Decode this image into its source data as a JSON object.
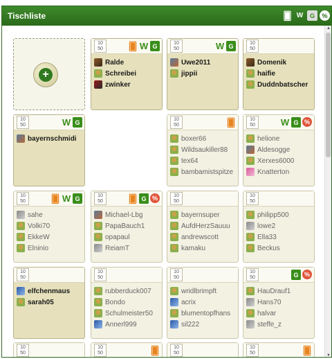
{
  "header": {
    "title": "Tischliste",
    "icons": [
      "cards-icon",
      "w-icon",
      "g-icon",
      "percent-icon"
    ],
    "w_label": "W",
    "g_label": "G",
    "pct_label": "%"
  },
  "tables": [
    {
      "type": "join",
      "min": "10",
      "max": "50"
    },
    {
      "min": "10",
      "max": "50",
      "filled": true,
      "badges": [
        "cards",
        "w",
        "g"
      ],
      "players": [
        {
          "name": "Ralde",
          "avatar": "photo1"
        },
        {
          "name": "Schreibei",
          "avatar": "green"
        },
        {
          "name": "zwinker",
          "avatar": "red"
        }
      ]
    },
    {
      "min": "10",
      "max": "50",
      "filled": true,
      "badges": [
        "w",
        "g"
      ],
      "players": [
        {
          "name": "Uwe2011",
          "avatar": "photo2"
        },
        {
          "name": "jippii",
          "avatar": "green"
        }
      ]
    },
    {
      "min": "10",
      "max": "50",
      "filled": true,
      "badges": [],
      "players": [
        {
          "name": "Domenik",
          "avatar": "photo1"
        },
        {
          "name": "haifie",
          "avatar": "green"
        },
        {
          "name": "Duddnbatscher",
          "avatar": "green"
        }
      ]
    },
    {
      "min": "10",
      "max": "50",
      "filled": true,
      "badges": [
        "w",
        "g"
      ],
      "players": [
        {
          "name": "bayernschmidi",
          "avatar": "photo2"
        }
      ]
    },
    {
      "type": "none"
    },
    {
      "min": "10",
      "max": "50",
      "filled": false,
      "badges": [
        "cards"
      ],
      "players": [
        {
          "name": "boxer66",
          "avatar": "green"
        },
        {
          "name": "Wildsaukiller88",
          "avatar": "green"
        },
        {
          "name": "tex64",
          "avatar": "green"
        },
        {
          "name": "bambamistspitze",
          "avatar": "green"
        }
      ]
    },
    {
      "min": "10",
      "max": "50",
      "filled": false,
      "badges": [
        "w",
        "g",
        "pct"
      ],
      "players": [
        {
          "name": "helione",
          "avatar": "green"
        },
        {
          "name": "Aldesogge",
          "avatar": "photo2"
        },
        {
          "name": "Xerxes6000",
          "avatar": "green"
        },
        {
          "name": "Knatterton",
          "avatar": "pink"
        }
      ]
    },
    {
      "min": "10",
      "max": "50",
      "filled": false,
      "badges": [
        "cards",
        "w",
        "g"
      ],
      "players": [
        {
          "name": "sahe",
          "avatar": "grey"
        },
        {
          "name": "Volki70",
          "avatar": "green"
        },
        {
          "name": "EkkeW",
          "avatar": "green"
        },
        {
          "name": "Elninio",
          "avatar": "green"
        }
      ]
    },
    {
      "min": "10",
      "max": "50",
      "filled": false,
      "badges": [
        "cards",
        "g",
        "pct"
      ],
      "players": [
        {
          "name": "Michael-Lbg",
          "avatar": "photo2"
        },
        {
          "name": "PapaBauch1",
          "avatar": "green"
        },
        {
          "name": "opapaul",
          "avatar": "green"
        },
        {
          "name": "ReiamT",
          "avatar": "grey"
        }
      ]
    },
    {
      "min": "10",
      "max": "50",
      "filled": false,
      "badges": [],
      "players": [
        {
          "name": "bayernsuper",
          "avatar": "green"
        },
        {
          "name": "AufdHerzSauuu",
          "avatar": "green"
        },
        {
          "name": "andrewscott",
          "avatar": "green"
        },
        {
          "name": "kamaku",
          "avatar": "green"
        }
      ]
    },
    {
      "min": "10",
      "max": "50",
      "filled": false,
      "badges": [],
      "players": [
        {
          "name": "philipp500",
          "avatar": "green"
        },
        {
          "name": "lowe2",
          "avatar": "grey"
        },
        {
          "name": "Ella33",
          "avatar": "green"
        },
        {
          "name": "Beckus",
          "avatar": "green"
        }
      ]
    },
    {
      "min": "10",
      "max": "50",
      "filled": true,
      "badges": [],
      "players": [
        {
          "name": "elfchenmaus",
          "avatar": "blue"
        },
        {
          "name": "sarah05",
          "avatar": "green"
        }
      ]
    },
    {
      "min": "10",
      "max": "50",
      "filled": false,
      "badges": [],
      "players": [
        {
          "name": "rubberduck007",
          "avatar": "green"
        },
        {
          "name": "Bondo",
          "avatar": "green"
        },
        {
          "name": "Schulmeister50",
          "avatar": "green"
        },
        {
          "name": "Annerl999",
          "avatar": "blue"
        }
      ]
    },
    {
      "min": "10",
      "max": "50",
      "filled": false,
      "badges": [],
      "players": [
        {
          "name": "wridlbrimpft",
          "avatar": "green"
        },
        {
          "name": "acrix",
          "avatar": "blue"
        },
        {
          "name": "blumentopfhans",
          "avatar": "green"
        },
        {
          "name": "sil222",
          "avatar": "blue"
        }
      ]
    },
    {
      "min": "10",
      "max": "50",
      "filled": false,
      "badges": [
        "g",
        "pct"
      ],
      "players": [
        {
          "name": "HauDrauf1",
          "avatar": "green"
        },
        {
          "name": "Hans70",
          "avatar": "grey"
        },
        {
          "name": "halvar",
          "avatar": "green"
        },
        {
          "name": "steffe_z",
          "avatar": "grey"
        }
      ]
    },
    {
      "min": "10",
      "max": "50",
      "filled": false,
      "badges": [],
      "players": []
    },
    {
      "min": "10",
      "max": "50",
      "filled": false,
      "badges": [
        "cards"
      ],
      "players": []
    },
    {
      "min": "10",
      "max": "50",
      "filled": false,
      "badges": [],
      "players": []
    },
    {
      "min": "10",
      "max": "50",
      "filled": false,
      "badges": [
        "cards"
      ],
      "players": []
    }
  ]
}
